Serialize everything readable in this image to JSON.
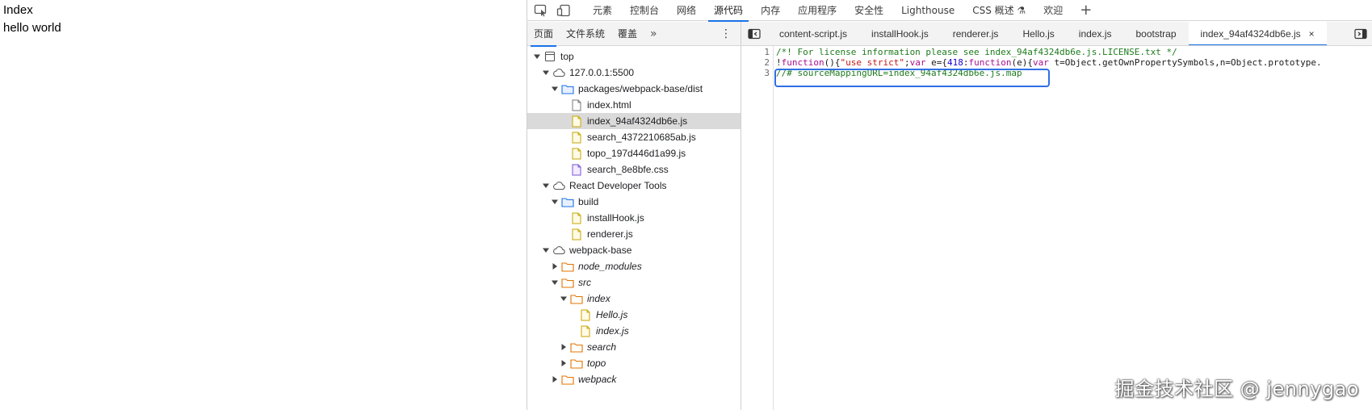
{
  "page": {
    "heading": "Index",
    "body_text": "hello world"
  },
  "devtools": {
    "topbar": {
      "tabs": [
        "元素",
        "控制台",
        "网络",
        "源代码",
        "内存",
        "应用程序",
        "安全性",
        "Lighthouse",
        "CSS 概述 ⚗",
        "欢迎"
      ],
      "active_tab": "源代码",
      "plus": "+"
    },
    "navigator": {
      "tabs": [
        "页面",
        "文件系统",
        "覆盖"
      ],
      "more": "»",
      "menu": "⋮",
      "tree": [
        {
          "label": "top",
          "depth": 0,
          "arrow": "down",
          "icon": "frame-icon"
        },
        {
          "label": "127.0.0.1:5500",
          "depth": 1,
          "arrow": "down",
          "icon": "cloud-icon"
        },
        {
          "label": "packages/webpack-base/dist",
          "depth": 2,
          "arrow": "down",
          "icon": "folder-blue-icon"
        },
        {
          "label": "index.html",
          "depth": 3,
          "arrow": "none",
          "icon": "file-icon"
        },
        {
          "label": "index_94af4324db6e.js",
          "depth": 3,
          "arrow": "none",
          "icon": "js-file-icon",
          "selected": true
        },
        {
          "label": "search_4372210685ab.js",
          "depth": 3,
          "arrow": "none",
          "icon": "js-file-icon"
        },
        {
          "label": "topo_197d446d1a99.js",
          "depth": 3,
          "arrow": "none",
          "icon": "js-file-icon"
        },
        {
          "label": "search_8e8bfe.css",
          "depth": 3,
          "arrow": "none",
          "icon": "css-file-icon"
        },
        {
          "label": "React Developer Tools",
          "depth": 1,
          "arrow": "down",
          "icon": "cloud-icon"
        },
        {
          "label": "build",
          "depth": 2,
          "arrow": "down",
          "icon": "folder-blue-icon"
        },
        {
          "label": "installHook.js",
          "depth": 3,
          "arrow": "none",
          "icon": "js-file-icon"
        },
        {
          "label": "renderer.js",
          "depth": 3,
          "arrow": "none",
          "icon": "js-file-icon"
        },
        {
          "label": "webpack-base",
          "depth": 1,
          "arrow": "down",
          "icon": "cloud-icon"
        },
        {
          "label": "node_modules",
          "depth": 2,
          "arrow": "right",
          "icon": "folder-orange-icon",
          "italic": true
        },
        {
          "label": "src",
          "depth": 2,
          "arrow": "down",
          "icon": "folder-orange-icon",
          "italic": true
        },
        {
          "label": "index",
          "depth": 3,
          "arrow": "down",
          "icon": "folder-orange-icon",
          "italic": true
        },
        {
          "label": "Hello.js",
          "depth": 4,
          "arrow": "none",
          "icon": "js-file-icon",
          "italic": true
        },
        {
          "label": "index.js",
          "depth": 4,
          "arrow": "none",
          "icon": "js-file-icon",
          "italic": true
        },
        {
          "label": "search",
          "depth": 3,
          "arrow": "right",
          "icon": "folder-orange-icon",
          "italic": true
        },
        {
          "label": "topo",
          "depth": 3,
          "arrow": "right",
          "icon": "folder-orange-icon",
          "italic": true
        },
        {
          "label": "webpack",
          "depth": 2,
          "arrow": "right",
          "icon": "folder-orange-icon",
          "italic": true
        }
      ]
    },
    "editor": {
      "tabs": [
        "content-script.js",
        "installHook.js",
        "renderer.js",
        "Hello.js",
        "index.js",
        "bootstrap",
        "index_94af4324db6e.js"
      ],
      "active_tab": "index_94af4324db6e.js",
      "close": "×",
      "line_numbers": [
        "1",
        "2",
        "3"
      ],
      "lines": {
        "l1": "/*! For license information please see index_94af4324db6e.js.LICENSE.txt */",
        "l2_a": "!",
        "l2_b": "function",
        "l2_c": "(){",
        "l2_d": "\"use strict\"",
        "l2_e": ";",
        "l2_f": "var",
        "l2_g": " e={",
        "l2_h": "418",
        "l2_i": ":",
        "l2_j": "function",
        "l2_k": "(e){",
        "l2_l": "var",
        "l2_m": " t=Object.getOwnPropertySymbols,n=Object.prototype.",
        "l3": "//# sourceMappingURL=index_94af4324db6e.js.map"
      }
    },
    "colors": {
      "accent": "#1a73e8",
      "highlight_box": "#2f6fe4",
      "comment": "#1d7b1d",
      "keyword": "#aa0d91",
      "string": "#c41a16"
    }
  },
  "watermark": "掘金技术社区 @ jennygao"
}
